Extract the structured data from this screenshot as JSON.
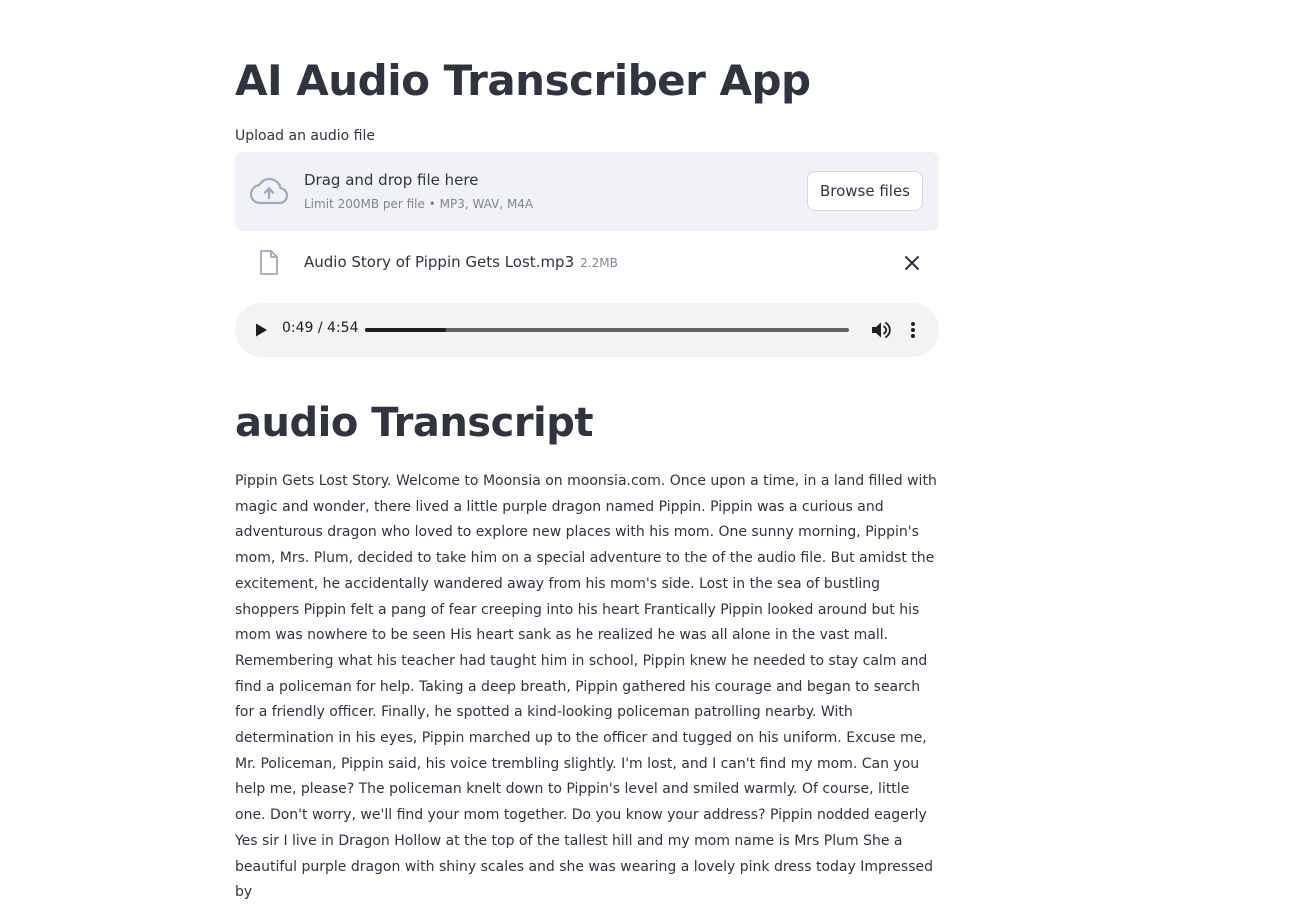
{
  "app": {
    "title": "AI Audio Transcriber App"
  },
  "uploader": {
    "label": "Upload an audio file",
    "drop_text": "Drag and drop file here",
    "limit_text": "Limit 200MB per file • MP3, WAV, M4A",
    "browse_label": "Browse files",
    "icon": "cloud-upload-icon"
  },
  "uploaded_file": {
    "name": "Audio Story of Pippin Gets Lost.mp3",
    "size": "2.2MB",
    "icon": "file-icon"
  },
  "audio_player": {
    "time": "0:49 / 4:54",
    "progress": 0.167
  },
  "transcript": {
    "heading": "audio Transcript",
    "text": "Pippin Gets Lost Story. Welcome to Moonsia on moonsia.com. Once upon a time, in a land filled with magic and wonder, there lived a little purple dragon named Pippin. Pippin was a curious and adventurous dragon who loved to explore new places with his mom. One sunny morning, Pippin's mom, Mrs. Plum, decided to take him on a special adventure to the of the audio file. But amidst the excitement, he accidentally wandered away from his mom's side. Lost in the sea of bustling shoppers Pippin felt a pang of fear creeping into his heart Frantically Pippin looked around but his mom was nowhere to be seen His heart sank as he realized he was all alone in the vast mall. Remembering what his teacher had taught him in school, Pippin knew he needed to stay calm and find a policeman for help. Taking a deep breath, Pippin gathered his courage and began to search for a friendly officer. Finally, he spotted a kind-looking policeman patrolling nearby. With determination in his eyes, Pippin marched up to the officer and tugged on his uniform. Excuse me, Mr. Policeman, Pippin said, his voice trembling slightly. I'm lost, and I can't find my mom. Can you help me, please? The policeman knelt down to Pippin's level and smiled warmly. Of course, little one. Don't worry, we'll find your mom together. Do you know your address? Pippin nodded eagerly Yes sir I live in Dragon Hollow at the top of the tallest hill and my mom name is Mrs Plum She a beautiful purple dragon with shiny scales and she was wearing a lovely pink dress today Impressed by"
  }
}
